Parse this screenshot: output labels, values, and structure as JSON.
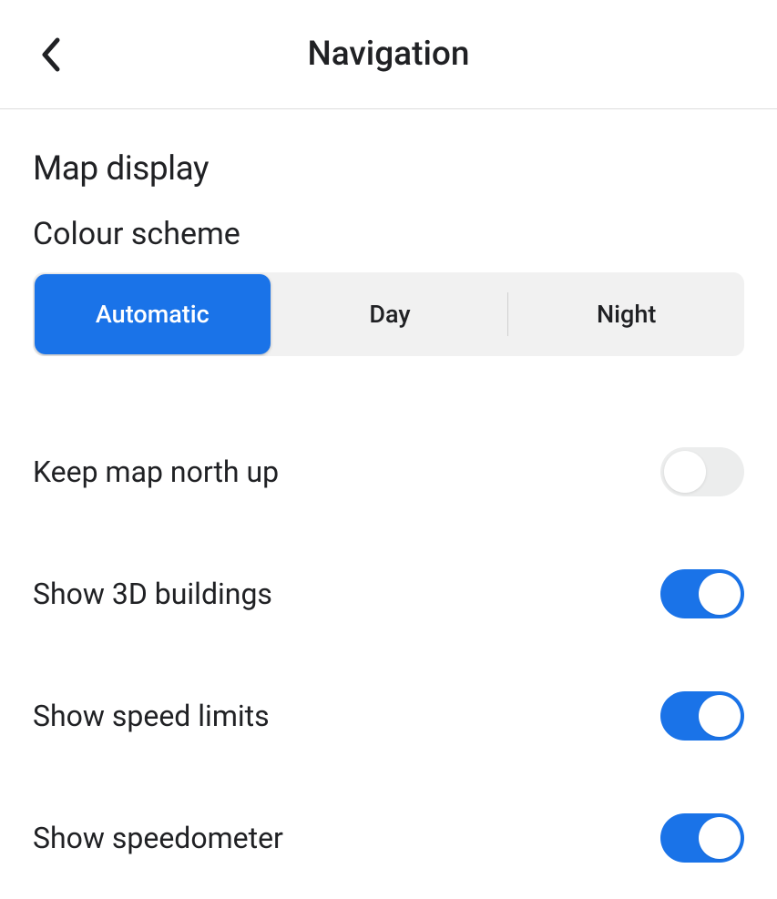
{
  "header": {
    "title": "Navigation"
  },
  "section": {
    "title": "Map display"
  },
  "colour_scheme": {
    "label": "Colour scheme",
    "options": {
      "automatic": "Automatic",
      "day": "Day",
      "night": "Night"
    },
    "selected": "automatic"
  },
  "settings": {
    "keep_north_up": {
      "label": "Keep map north up",
      "value": false
    },
    "show_3d_buildings": {
      "label": "Show 3D buildings",
      "value": true
    },
    "show_speed_limits": {
      "label": "Show speed limits",
      "value": true
    },
    "show_speedometer": {
      "label": "Show speedometer",
      "value": true
    }
  }
}
